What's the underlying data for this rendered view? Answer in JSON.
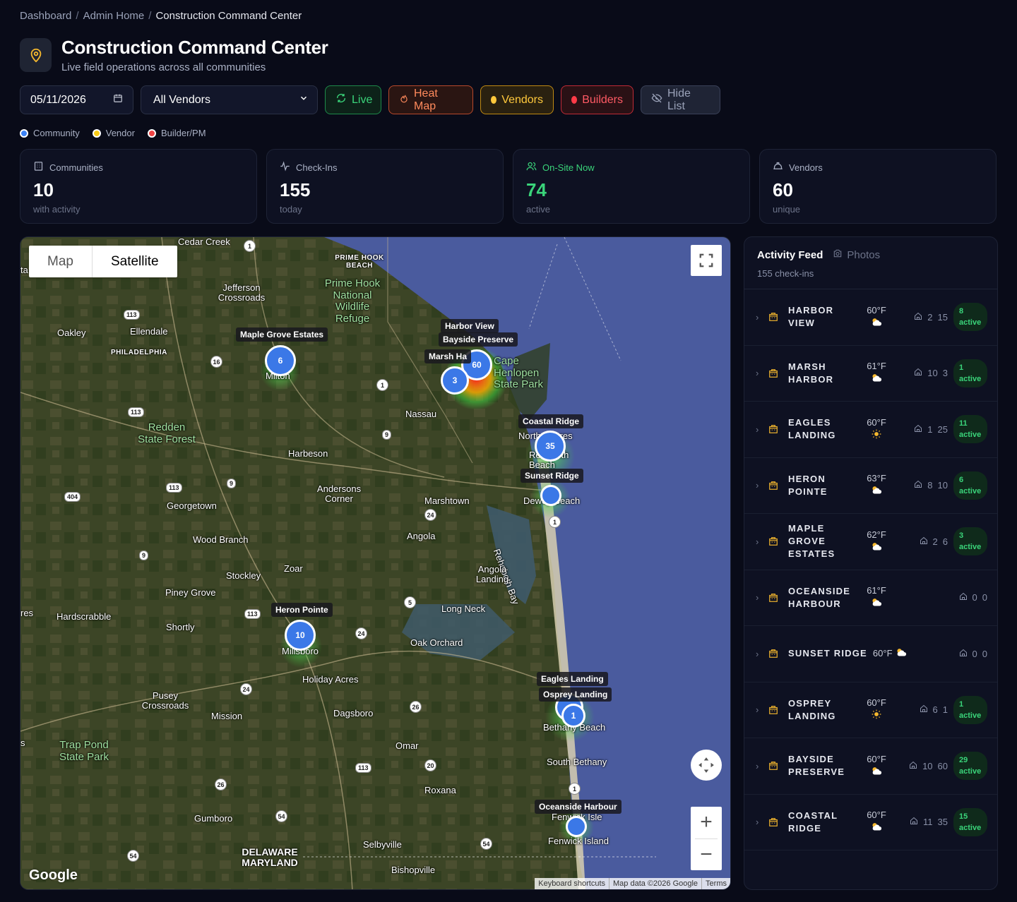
{
  "breadcrumb": [
    "Dashboard",
    "Admin Home",
    "Construction Command Center"
  ],
  "breadcrumb_sep": "/",
  "header": {
    "title": "Construction Command Center",
    "subtitle": "Live field operations across all communities"
  },
  "toolbar": {
    "date_value": "05/11/2026",
    "vendor_select": "All Vendors",
    "live_label": "Live",
    "heatmap_label": "Heat Map",
    "vendors_label": "Vendors",
    "builders_label": "Builders",
    "hide_list_label": "Hide List"
  },
  "legend": [
    {
      "label": "Community",
      "color": "#3b82f6"
    },
    {
      "label": "Vendor",
      "color": "#facc15"
    },
    {
      "label": "Builder/PM",
      "color": "#ef4444"
    }
  ],
  "stats": [
    {
      "label": "Communities",
      "value": "10",
      "sub": "with activity",
      "icon": "building-icon"
    },
    {
      "label": "Check-Ins",
      "value": "155",
      "sub": "today",
      "icon": "pulse-icon"
    },
    {
      "label": "On-Site Now",
      "value": "74",
      "sub": "active",
      "icon": "users-icon"
    },
    {
      "label": "Vendors",
      "value": "60",
      "sub": "unique",
      "icon": "hardhat-icon"
    }
  ],
  "map": {
    "type_map": "Map",
    "type_satellite": "Satellite",
    "google": "Google",
    "attribution": [
      "Keyboard shortcuts",
      "Map data ©2026 Google",
      "Terms"
    ],
    "zoom_in": "+",
    "zoom_out": "−",
    "places": {
      "cedar_creek": "Cedar Creek",
      "prime_hook_beach": "PRIME HOOK BEACH",
      "prime_hook_refuge": "Prime Hook National Wildlife Refuge",
      "jefferson": "Jefferson Crossroads",
      "oakley": "Oakley",
      "ellendale": "Ellendale",
      "philadelphia": "PHILADELPHIA",
      "milton": "Milton",
      "cape_henlopen": "Cape Henlopen State Park",
      "nassau": "Nassau",
      "redden": "Redden State Forest",
      "harbeson": "Harbeson",
      "north_shores": "North Shores",
      "rehoboth": "Rehoboth Beach",
      "andersons": "Andersons Corner",
      "georgetown": "Georgetown",
      "marshtown": "Marshtown",
      "dewey": "Dewey Beach",
      "wood_branch": "Wood Branch",
      "angola": "Angola",
      "rehoboth_bay": "Rehoboth Bay",
      "stockley": "Stockley",
      "zoar": "Zoar",
      "angola_landing": "Angola Landing",
      "piney_grove": "Piney Grove",
      "long_neck": "Long Neck",
      "hardscrabble": "Hardscrabble",
      "res": "res",
      "shortly": "Shortly",
      "oak_orchard": "Oak Orchard",
      "millsboro": "Millsboro",
      "holiday_acres": "Holiday Acres",
      "pusey": "Pusey Crossroads",
      "mission": "Mission",
      "dagsboro": "Dagsboro",
      "bethany": "Bethany Beach",
      "trap_pond": "Trap Pond State Park",
      "omar": "Omar",
      "south_bethany": "South Bethany",
      "roxana": "Roxana",
      "gumboro": "Gumboro",
      "fenwick_isle": "Fenwick Isle",
      "fenwick_island": "Fenwick Island",
      "selbyville": "Selbyville",
      "delaware_maryland": "DELAWARE MARYLAND",
      "bishopville": "Bishopville",
      "ta": "ta",
      "s": "s"
    },
    "shields": [
      "1",
      "113",
      "16",
      "1",
      "113",
      "9",
      "113",
      "9",
      "404",
      "24",
      "1",
      "9",
      "5",
      "113",
      "24",
      "24",
      "26",
      "113",
      "20",
      "26",
      "1",
      "54",
      "54",
      "54"
    ],
    "community_labels": {
      "harbor_view": "Harbor View",
      "bayside_preserve": "Bayside Preserve",
      "marsh_harbor": "Marsh Ha",
      "maple_grove": "Maple Grove Estates",
      "coastal_ridge": "Coastal Ridge",
      "sunset_ridge": "Sunset Ridge",
      "heron_pointe": "Heron Pointe",
      "eagles_landing": "Eagles Landing",
      "osprey_landing": "Osprey Landing",
      "oceanside": "Oceanside Harbour"
    },
    "clusters": {
      "maple": "6",
      "cape_a": "60",
      "cape_b": "3",
      "coastal": "35",
      "sunset": "",
      "heron": "10",
      "bethany_a": "",
      "bethany_b": "1",
      "fenwick": ""
    }
  },
  "feed": {
    "title": "Activity Feed",
    "photos_tab": "Photos",
    "count": "155 check-ins",
    "rows": [
      {
        "name": "Harbor View",
        "temp": "60°F",
        "weather": "partly-cloudy",
        "homes": "2",
        "checkins": "15",
        "active_count": "8",
        "active_label": "active"
      },
      {
        "name": "Marsh Harbor",
        "temp": "61°F",
        "weather": "partly-cloudy",
        "homes": "10",
        "checkins": "3",
        "active_count": "1",
        "active_label": "active"
      },
      {
        "name": "Eagles Landing",
        "temp": "60°F",
        "weather": "sunny",
        "homes": "1",
        "checkins": "25",
        "active_count": "11",
        "active_label": "active"
      },
      {
        "name": "Heron Pointe",
        "temp": "63°F",
        "weather": "partly-cloudy",
        "homes": "8",
        "checkins": "10",
        "active_count": "6",
        "active_label": "active"
      },
      {
        "name": "Maple Grove Estates",
        "temp": "62°F",
        "weather": "partly-cloudy",
        "homes": "2",
        "checkins": "6",
        "active_count": "3",
        "active_label": "active"
      },
      {
        "name": "Oceanside Harbour",
        "temp": "61°F",
        "weather": "partly-cloudy",
        "homes": "0",
        "checkins": "0",
        "active_count": "",
        "active_label": ""
      },
      {
        "name": "Sunset Ridge",
        "temp": "60°F",
        "weather": "partly-cloudy",
        "homes": "0",
        "checkins": "0",
        "active_count": "",
        "active_label": ""
      },
      {
        "name": "Osprey Landing",
        "temp": "60°F",
        "weather": "sunny",
        "homes": "6",
        "checkins": "1",
        "active_count": "1",
        "active_label": "active"
      },
      {
        "name": "Bayside Preserve",
        "temp": "60°F",
        "weather": "partly-cloudy",
        "homes": "10",
        "checkins": "60",
        "active_count": "29",
        "active_label": "active"
      },
      {
        "name": "Coastal Ridge",
        "temp": "60°F",
        "weather": "partly-cloudy",
        "homes": "11",
        "checkins": "35",
        "active_count": "15",
        "active_label": "active"
      }
    ]
  },
  "colors": {
    "accent_green": "#3ad47a",
    "heat_orange": "#ff8a5c",
    "vendor_yellow": "#ffc93c",
    "builder_red": "#ff5a64",
    "community_blue": "#3b78e7"
  }
}
